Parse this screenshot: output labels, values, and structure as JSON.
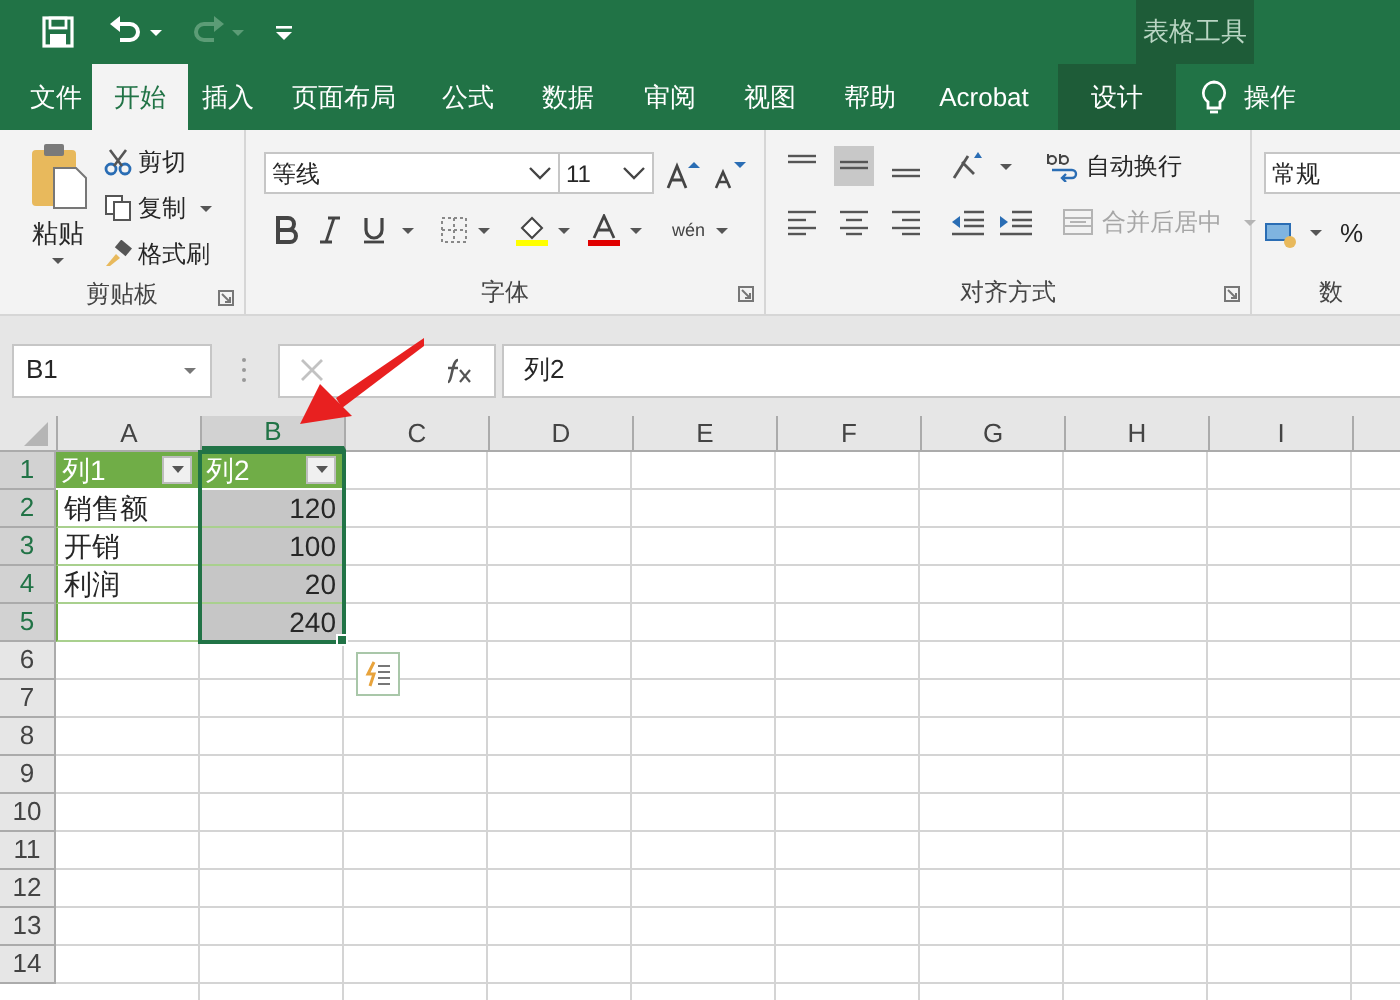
{
  "title_bar": {
    "context_label": "表格工具"
  },
  "tabs": [
    {
      "label": "文件",
      "selected": false,
      "kind": "normal"
    },
    {
      "label": "开始",
      "selected": true,
      "kind": "normal"
    },
    {
      "label": "插入",
      "selected": false,
      "kind": "normal"
    },
    {
      "label": "页面布局",
      "selected": false,
      "kind": "normal"
    },
    {
      "label": "公式",
      "selected": false,
      "kind": "normal"
    },
    {
      "label": "数据",
      "selected": false,
      "kind": "normal"
    },
    {
      "label": "审阅",
      "selected": false,
      "kind": "normal"
    },
    {
      "label": "视图",
      "selected": false,
      "kind": "normal"
    },
    {
      "label": "帮助",
      "selected": false,
      "kind": "normal"
    },
    {
      "label": "Acrobat",
      "selected": false,
      "kind": "normal"
    },
    {
      "label": "设计",
      "selected": false,
      "kind": "contextual"
    }
  ],
  "tell_me": "操作",
  "ribbon": {
    "clipboard": {
      "paste": "粘贴",
      "cut": "剪切",
      "copy": "复制",
      "format_painter": "格式刷",
      "label": "剪贴板"
    },
    "font": {
      "name": "等线",
      "size": "11",
      "phonetic": "wén",
      "label": "字体"
    },
    "alignment": {
      "wrap_text": "自动换行",
      "merge": {
        "label": "合并后居中",
        "disabled": true
      },
      "label": "对齐方式"
    },
    "number": {
      "format": "常规",
      "percent": "%",
      "label": "数"
    }
  },
  "formula_bar": {
    "name_box": "B1",
    "value": "列2"
  },
  "sheet": {
    "columns": [
      {
        "label": "A",
        "selected": false
      },
      {
        "label": "B",
        "selected": true
      },
      {
        "label": "C",
        "selected": false
      },
      {
        "label": "D",
        "selected": false
      },
      {
        "label": "E",
        "selected": false
      },
      {
        "label": "F",
        "selected": false
      },
      {
        "label": "G",
        "selected": false
      },
      {
        "label": "H",
        "selected": false
      },
      {
        "label": "I",
        "selected": false
      }
    ],
    "rows": [
      {
        "label": "1",
        "selected": true,
        "kind": "table_header",
        "column_a": "列1",
        "column_b": "列2"
      },
      {
        "label": "2",
        "selected": true,
        "kind": "table_row",
        "column_a": "销售额",
        "column_b": "120"
      },
      {
        "label": "3",
        "selected": true,
        "kind": "table_row",
        "column_a": "开销",
        "column_b": "100"
      },
      {
        "label": "4",
        "selected": true,
        "kind": "table_row",
        "column_a": "利润",
        "column_b": "20"
      },
      {
        "label": "5",
        "selected": true,
        "kind": "table_row",
        "column_b": "240"
      },
      {
        "label": "6",
        "selected": false,
        "kind": "plain"
      },
      {
        "label": "7",
        "selected": false,
        "kind": "plain"
      },
      {
        "label": "8",
        "selected": false,
        "kind": "plain"
      },
      {
        "label": "9",
        "selected": false,
        "kind": "plain"
      },
      {
        "label": "10",
        "selected": false,
        "kind": "plain"
      },
      {
        "label": "11",
        "selected": false,
        "kind": "plain"
      },
      {
        "label": "12",
        "selected": false,
        "kind": "plain"
      },
      {
        "label": "13",
        "selected": false,
        "kind": "plain"
      },
      {
        "label": "14",
        "selected": false,
        "kind": "plain"
      }
    ]
  }
}
